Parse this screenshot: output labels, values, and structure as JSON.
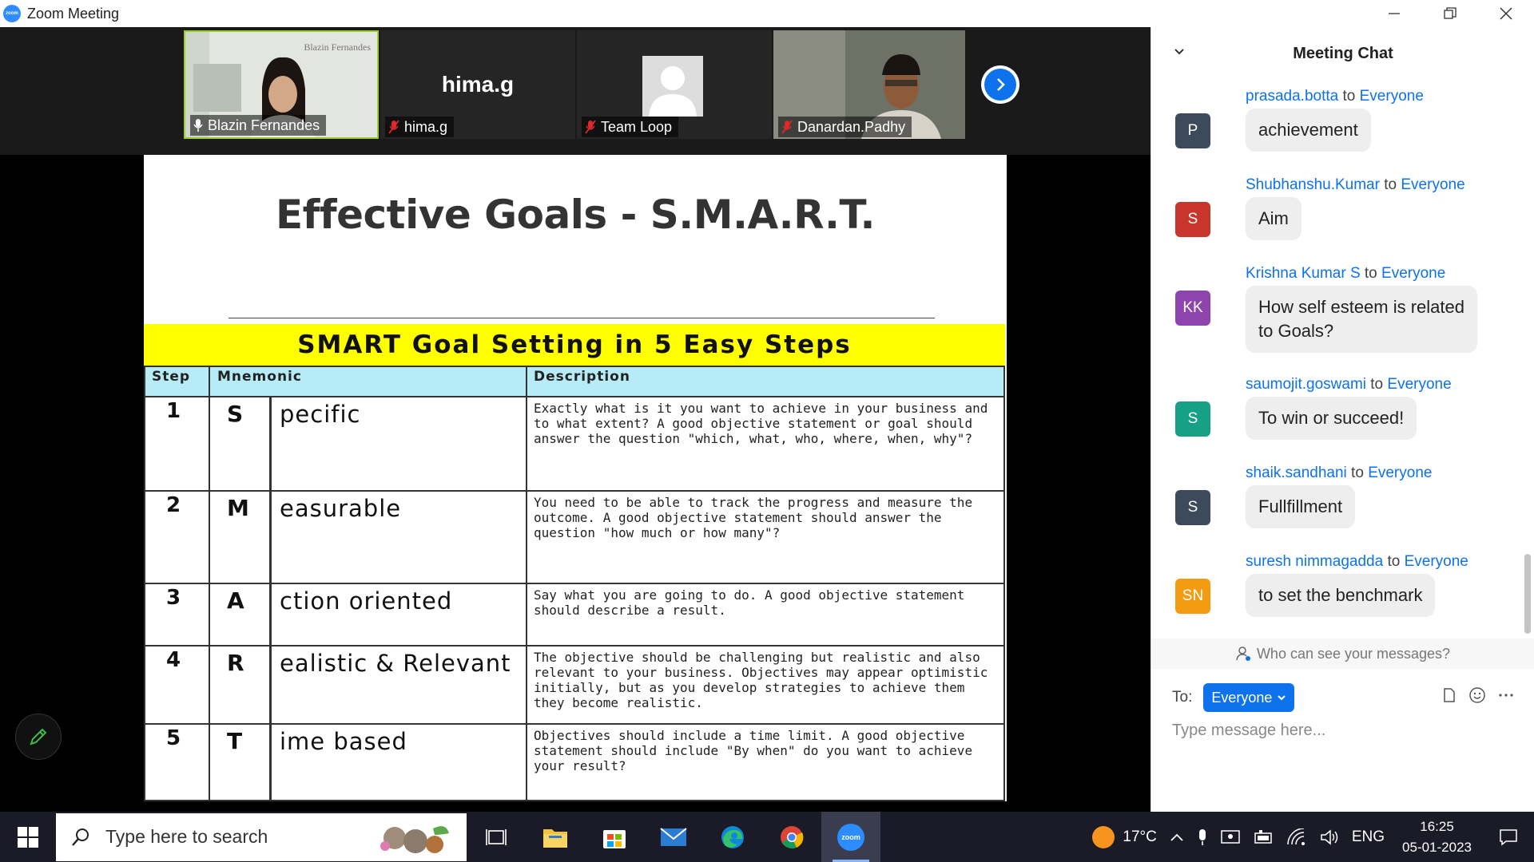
{
  "window": {
    "title": "Zoom Meeting",
    "logo_text": "zoom"
  },
  "participants": [
    {
      "name": "Blazin Fernandes",
      "has_video": true,
      "muted": false,
      "watermark": "Blazin Fernandes"
    },
    {
      "name": "hima.g",
      "has_video": false,
      "muted": true,
      "center_label": "hima.g"
    },
    {
      "name": "Team Loop",
      "has_video": false,
      "muted": true
    },
    {
      "name": "Danardan.Padhy",
      "has_video": true,
      "muted": true
    }
  ],
  "slide": {
    "title": "Effective Goals - S.M.A.R.T.",
    "banner": "SMART Goal Setting in 5 Easy Steps",
    "headers": {
      "step": "Step",
      "mnemonic": "Mnemonic",
      "description": "Description"
    },
    "rows": [
      {
        "num": "1",
        "letter": "S",
        "word": "pecific",
        "desc": "Exactly what is it you want to achieve in your business and to what extent?  A good objective statement or goal should answer the question \"which, what, who, where, when, why\"?"
      },
      {
        "num": "2",
        "letter": "M",
        "word": "easurable",
        "desc": "You need to be able to track the progress and measure the outcome.  A good objective statement should answer the question \"how much or how many\"?"
      },
      {
        "num": "3",
        "letter": "A",
        "word": "ction oriented",
        "desc": "Say what you are going to do.  A good objective statement should describe a result."
      },
      {
        "num": "4",
        "letter": "R",
        "word": "ealistic & Relevant",
        "desc": "The objective should be challenging but realistic and also relevant to your business.  Objectives may appear optimistic initially, but as you develop strategies to achieve them they become realistic."
      },
      {
        "num": "5",
        "letter": "T",
        "word": "ime based",
        "desc": "Objectives should include a time limit.  A good objective statement should include \"By when\" do you want to achieve your result?"
      }
    ]
  },
  "chat": {
    "title": "Meeting Chat",
    "to_word": "to",
    "messages": [
      {
        "sender": "prasada.botta",
        "recipient": "Everyone",
        "initials": "P",
        "color": "#3d4a5c",
        "text": "achievement"
      },
      {
        "sender": "Shubhanshu.Kumar",
        "recipient": "Everyone",
        "initials": "S",
        "color": "#c8352b",
        "text": "Aim"
      },
      {
        "sender": "Krishna Kumar S",
        "recipient": "Everyone",
        "initials": "KK",
        "color": "#8e44ad",
        "text": "How self esteem is related\nto Goals?"
      },
      {
        "sender": "saumojit.goswami",
        "recipient": "Everyone",
        "initials": "S",
        "color": "#16a085",
        "text": "To win or succeed!"
      },
      {
        "sender": "shaik.sandhani",
        "recipient": "Everyone",
        "initials": "S",
        "color": "#3d4a5c",
        "text": "Fullfillment"
      },
      {
        "sender": "suresh nimmagadda",
        "recipient": "Everyone",
        "initials": "SN",
        "color": "#f39c12",
        "text": "to set the benchmark"
      }
    ],
    "who_can_see": "Who can see your messages?",
    "to_label": "To:",
    "to_value": "Everyone",
    "input_placeholder": "Type message here..."
  },
  "taskbar": {
    "search_placeholder": "Type here to search",
    "weather": "17°C",
    "language": "ENG",
    "time": "16:25",
    "date": "05-01-2023",
    "zoom_label": "zoom"
  }
}
